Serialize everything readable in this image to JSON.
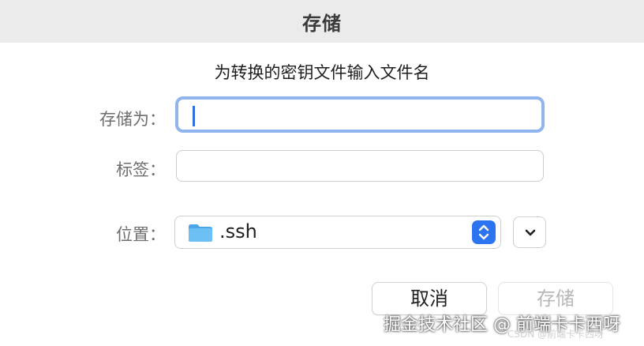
{
  "dialog": {
    "title": "存储",
    "prompt": "为转换的密钥文件输入文件名"
  },
  "fields": {
    "save_as_label": "存储为：",
    "save_as_value": "",
    "tags_label": "标签：",
    "tags_value": "",
    "location_label": "位置：",
    "location_value": ".ssh"
  },
  "buttons": {
    "cancel": "取消",
    "save": "存储"
  },
  "watermark": {
    "main": "掘金技术社区 @ 前端卡卡西呀",
    "small": "CSDN @前端卡卡西呀"
  },
  "colors": {
    "accent": "#2d74f0",
    "focus_ring": "#8fb4ee",
    "folder": "#5fb6f0"
  },
  "icons": {
    "location": "folder-icon",
    "stepper": "up-down-chevron-icon",
    "expand": "chevron-down-icon"
  }
}
